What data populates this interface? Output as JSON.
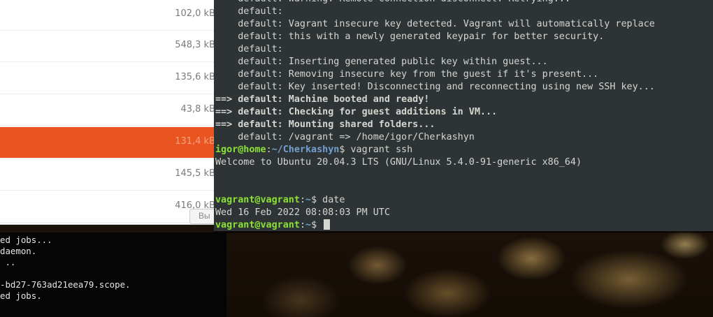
{
  "file_manager": {
    "sizes": [
      "102,0 kB",
      "548,3 kB",
      "135,6 kB",
      "43,8 kB",
      "131,4 kB",
      "145,5 kB",
      "416,0 kB"
    ],
    "selected_index": 4,
    "button_label": "Вы"
  },
  "background_terminal": {
    "lines": [
      "ed jobs...",
      "daemon.",
      " ..",
      "",
      "-bd27-763ad21eea79.scope.",
      "ed jobs."
    ]
  },
  "terminal": {
    "lines": [
      {
        "text": "    default: Warning: Remote connection disconnect. Retrying..."
      },
      {
        "text": "    default:"
      },
      {
        "text": "    default: Vagrant insecure key detected. Vagrant will automatically replace"
      },
      {
        "text": "    default: this with a newly generated keypair for better security."
      },
      {
        "text": "    default:"
      },
      {
        "text": "    default: Inserting generated public key within guest..."
      },
      {
        "text": "    default: Removing insecure key from the guest if it's present..."
      },
      {
        "text": "    default: Key inserted! Disconnecting and reconnecting using new SSH key..."
      },
      {
        "bold": "==> default: Machine booted and ready!"
      },
      {
        "bold": "==> default: Checking for guest additions in VM..."
      },
      {
        "bold": "==> default: Mounting shared folders..."
      },
      {
        "text": "    default: /vagrant => /home/igor/Cherkashyn"
      },
      {
        "user": "igor@home",
        "sep": ":",
        "path": "~/Cherkashyn",
        "cmd": "$ vagrant ssh"
      },
      {
        "text": "Welcome to Ubuntu 20.04.3 LTS (GNU/Linux 5.4.0-91-generic x86_64)"
      },
      {
        "text": ""
      },
      {
        "text": ""
      },
      {
        "user": "vagrant@vagrant",
        "sep": ":",
        "path": "~",
        "cmd": "$ date"
      },
      {
        "text": "Wed 16 Feb 2022 08:08:03 PM UTC"
      },
      {
        "user": "vagrant@vagrant",
        "sep": ":",
        "path": "~",
        "cmd": "$ ",
        "cursor": true
      }
    ]
  },
  "colors": {
    "terminal_bg": "#2e3436",
    "terminal_fg": "#d3d7cf",
    "prompt_user": "#8ae234",
    "prompt_path": "#729fcf",
    "selection": "#e95420"
  }
}
